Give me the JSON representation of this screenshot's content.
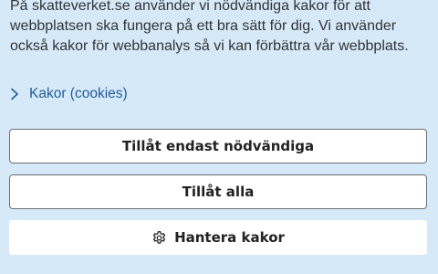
{
  "cookie_banner": {
    "intro_text": "På skatteverket.se använder vi nödvändiga kakor för att webbplatsen ska fungera på ett bra sätt för dig. Vi använder också kakor för webbanalys så vi kan förbättra vår webbplats.",
    "details_link": "Kakor (cookies)",
    "buttons": {
      "necessary_only": "Tillåt endast nödvändiga",
      "allow_all": "Tillåt alla",
      "manage": "Hantera kakor"
    },
    "icons": {
      "details_link": "chevron-right-icon",
      "manage": "gear-icon"
    },
    "colors": {
      "background": "#d6e9f9",
      "link": "#1f5c99",
      "button_bg": "#ffffff",
      "button_border": "#6e6e6e",
      "text": "#333333"
    }
  }
}
